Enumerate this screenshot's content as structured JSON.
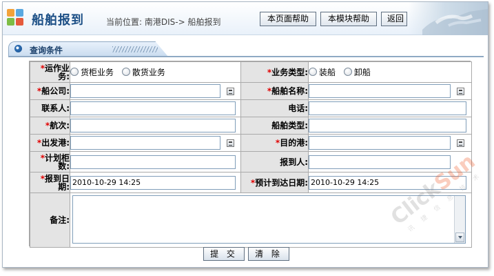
{
  "header": {
    "title": "船舶报到",
    "breadcrumb": "当前位置: 南港DIS-> 船舶报到",
    "buttons": {
      "page_help": "本页面帮助",
      "module_help": "本模块帮助",
      "back": "返回"
    }
  },
  "section": {
    "title": "查询条件"
  },
  "form": {
    "required_mark": "*",
    "op_business": {
      "label": "运作业务:",
      "options": [
        "货柜业务",
        "散货业务"
      ]
    },
    "business_type": {
      "label": "业务类型:",
      "options": [
        "装船",
        "卸船"
      ]
    },
    "ship_company": {
      "label": "船公司:",
      "value": ""
    },
    "ship_name": {
      "label": "船舶名称:",
      "value": ""
    },
    "contact": {
      "label": "联系人:",
      "value": ""
    },
    "phone": {
      "label": "电话:",
      "value": ""
    },
    "voyage": {
      "label": "航次:",
      "value": ""
    },
    "ship_type": {
      "label": "船舶类型:",
      "value": ""
    },
    "departure_port": {
      "label": "出发港:",
      "value": ""
    },
    "destination_port": {
      "label": "目的港:",
      "value": ""
    },
    "planned_containers": {
      "label": "计划柜数:",
      "value": ""
    },
    "reporter": {
      "label": "报到人:",
      "value": ""
    },
    "report_date": {
      "label": "报到日期:",
      "value": "2010-10-29 14:25"
    },
    "eta": {
      "label": "预计到达日期:",
      "value": "2010-10-29 14:25"
    },
    "remarks": {
      "label": "备注:",
      "value": ""
    }
  },
  "actions": {
    "submit": "提 交",
    "clear": "清 除"
  },
  "watermark": {
    "brand_a": "Click",
    "brand_b": "Sun",
    "sub": "讯 捷 信 息 技 术"
  },
  "colors": {
    "accent": "#1c4f86",
    "required": "#e00000",
    "label_bg": "#e4e4e4"
  }
}
